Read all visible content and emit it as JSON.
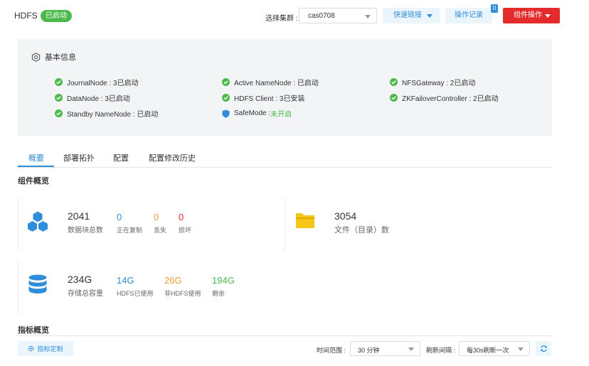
{
  "header": {
    "title": "HDFS",
    "status": "已启动",
    "cluster_label": "选择集群 :",
    "cluster_value": "cas0708",
    "quick_link_label": "快速链接",
    "op_log_label": "操作记录",
    "op_log_badge": "0",
    "component_op_label": "组件操作"
  },
  "basic_info": {
    "title": "基本信息",
    "items": [
      {
        "label": "JournalNode : 3已启动"
      },
      {
        "label": "Active NameNode : 已启动"
      },
      {
        "label": "NFSGateway : 2已启动"
      },
      {
        "label": "DataNode : 3已启动"
      },
      {
        "label": "HDFS Client : 3已安装"
      },
      {
        "label": "ZKFailoverController : 2已启动"
      },
      {
        "label": "Standby NameNode : 已启动"
      }
    ],
    "safemode_label": "SafeMode : ",
    "safemode_value": "未开启"
  },
  "tabs": [
    {
      "label": "概要"
    },
    {
      "label": "部署拓扑"
    },
    {
      "label": "配置"
    },
    {
      "label": "配置修改历史"
    }
  ],
  "overview": {
    "title": "组件概览",
    "blocks": {
      "total": "2041",
      "total_label": "数据块总数",
      "replicating": "0",
      "replicating_label": "正在复制",
      "lost": "0",
      "lost_label": "丢失",
      "corrupt": "0",
      "corrupt_label": "损坏"
    },
    "files": {
      "total": "3054",
      "total_label": "文件（目录）数"
    },
    "storage": {
      "total": "234G",
      "total_label": "存储总容量",
      "hdfs_used": "14G",
      "hdfs_used_label": "HDFS已使用",
      "non_hdfs_used": "26G",
      "non_hdfs_used_label": "非HDFS使用",
      "remaining": "194G",
      "remaining_label": "剩余"
    }
  },
  "metrics": {
    "title": "指标概览",
    "customize_label": "指标定制",
    "time_range_label": "时间范围 :",
    "time_range_value": "30 分钟",
    "refresh_label": "刷新间隔 :",
    "refresh_value": "每30s刷新一次"
  },
  "colors": {
    "accent": "#2f8ed9",
    "success": "#4cb94c",
    "warning": "#f39b38",
    "danger": "#e32b2b",
    "folder": "#f5c518"
  }
}
